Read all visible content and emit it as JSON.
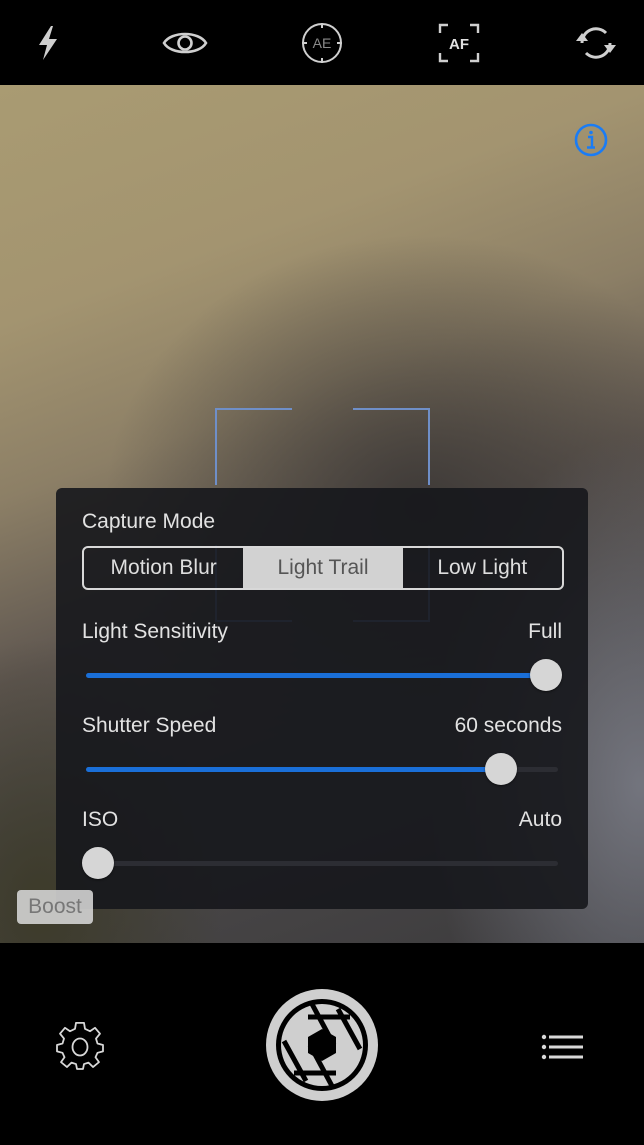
{
  "top_toolbar": {
    "icons": [
      {
        "name": "flash-icon"
      },
      {
        "name": "eye-icon"
      },
      {
        "name": "ae-lock-icon",
        "label": "AE"
      },
      {
        "name": "af-lock-icon",
        "label": "AF"
      },
      {
        "name": "switch-camera-icon"
      }
    ]
  },
  "viewfinder": {
    "info_icon": "info-icon"
  },
  "capture_panel": {
    "title": "Capture Mode",
    "modes": [
      "Motion Blur",
      "Light Trail",
      "Low Light"
    ],
    "selected_mode": "Light Trail",
    "sliders": [
      {
        "label": "Light Sensitivity",
        "value_text": "Full",
        "fraction": 1.0
      },
      {
        "label": "Shutter Speed",
        "value_text": "60 seconds",
        "fraction": 0.9
      },
      {
        "label": "ISO",
        "value_text": "Auto",
        "fraction": 0.0
      }
    ]
  },
  "boost_button": "Boost",
  "bottom_toolbar": {
    "settings_icon": "gear-icon",
    "shutter_icon": "shutter-aperture-icon",
    "menu_icon": "list-icon"
  },
  "colors": {
    "accent": "#1a6fd8",
    "info_icon": "#1a7cf5",
    "focus_bracket": "#6f8fc8"
  }
}
